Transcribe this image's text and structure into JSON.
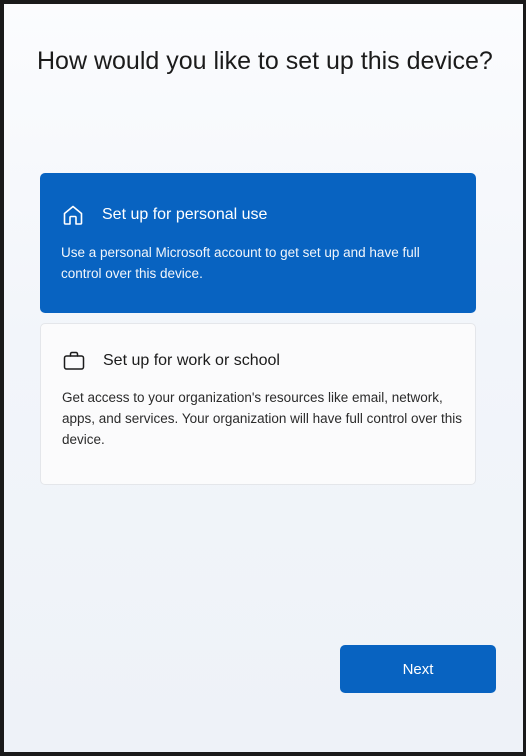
{
  "page": {
    "title": "How would you like to set up this device?"
  },
  "options": [
    {
      "icon": "home-icon",
      "title": "Set up for personal use",
      "description": "Use a personal Microsoft account to get set up and have full control over this device.",
      "selected": true
    },
    {
      "icon": "briefcase-icon",
      "title": "Set up for work or school",
      "description": "Get access to your organization's resources like email, network, apps, and services. Your organization will have full control over this device.",
      "selected": false
    }
  ],
  "footer": {
    "next_label": "Next"
  },
  "colors": {
    "accent": "#0863c1",
    "card_background": "#fbfbfc",
    "text": "#1b1b1b"
  }
}
